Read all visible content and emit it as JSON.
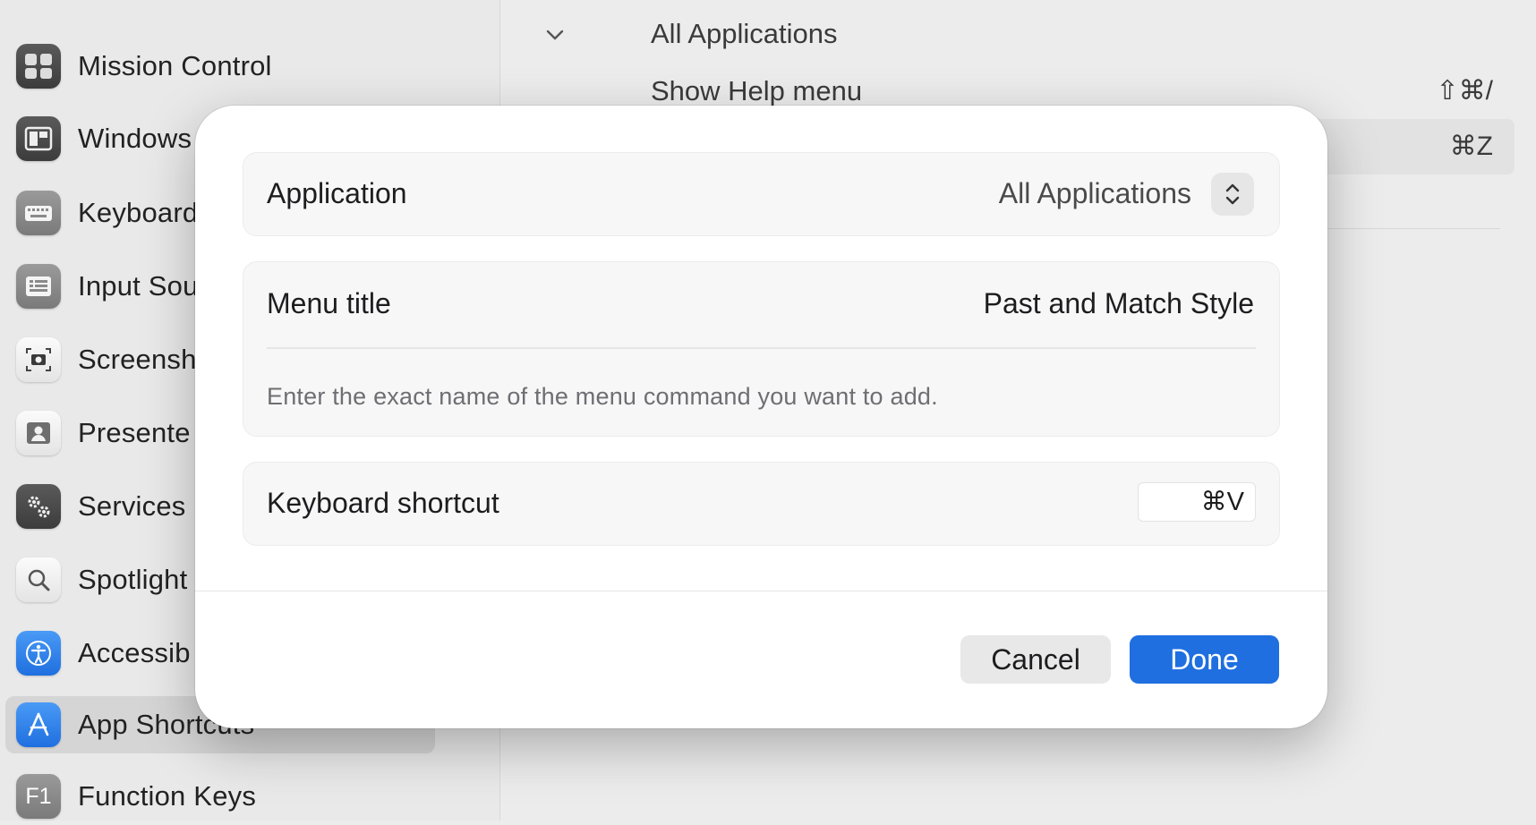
{
  "sidebar": {
    "items": [
      {
        "label": "Mission Control",
        "icon": "mission-control-icon"
      },
      {
        "label": "Windows",
        "icon": "windows-icon"
      },
      {
        "label": "Keyboard",
        "icon": "keyboard-icon"
      },
      {
        "label": "Input Sou",
        "icon": "input-sources-icon"
      },
      {
        "label": "Screensh",
        "icon": "screenshot-icon"
      },
      {
        "label": "Presente",
        "icon": "presenter-icon"
      },
      {
        "label": "Services",
        "icon": "services-icon"
      },
      {
        "label": "Spotlight",
        "icon": "spotlight-icon"
      },
      {
        "label": "Accessib",
        "icon": "accessibility-icon"
      },
      {
        "label": "App Shortcuts",
        "icon": "app-store-icon",
        "selected": true
      },
      {
        "label": "Function Keys",
        "icon": "function-keys-icon"
      }
    ]
  },
  "content": {
    "group_title": "All Applications",
    "rows": [
      {
        "label": "Show Help menu",
        "shortcut": "⇧⌘/"
      },
      {
        "label": "",
        "shortcut": "⌘Z"
      }
    ]
  },
  "dialog": {
    "application": {
      "label": "Application",
      "value": "All Applications"
    },
    "menu_title": {
      "label": "Menu title",
      "value": "Past and Match Style",
      "hint": "Enter the exact name of the menu command you want to add."
    },
    "keyboard_shortcut": {
      "label": "Keyboard shortcut",
      "value": "⌘V"
    },
    "buttons": {
      "cancel": "Cancel",
      "done": "Done"
    }
  },
  "colors": {
    "accent": "#1f6fe0",
    "window_background": "#ececec",
    "dialog_background": "#ffffff"
  }
}
